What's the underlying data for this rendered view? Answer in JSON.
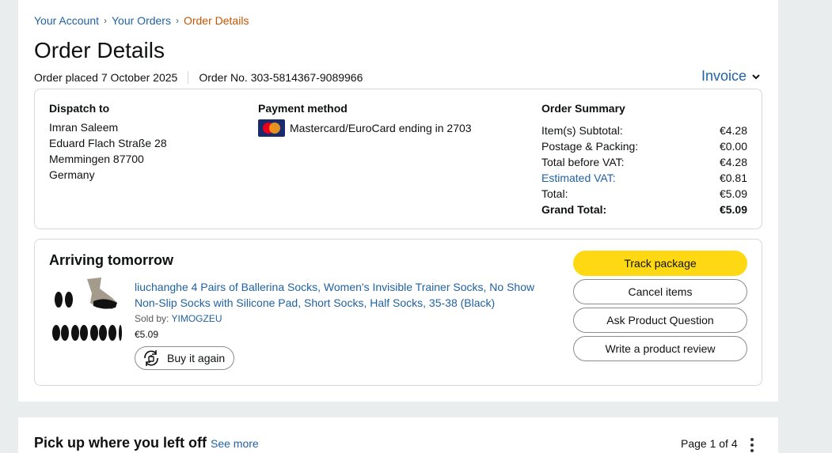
{
  "breadcrumb": {
    "items": [
      "Your Account",
      "Your Orders"
    ],
    "separator": "›",
    "current": "Order Details"
  },
  "page_title": "Order Details",
  "order_meta": {
    "placed": "Order placed 7 October 2025",
    "number": "Order No. 303-5814367-9089966"
  },
  "invoice_label": "Invoice",
  "dispatch": {
    "heading": "Dispatch to",
    "lines": [
      "Imran Saleem",
      "Eduard Flach Straße 28",
      "Memmingen 87700",
      "Germany"
    ]
  },
  "payment": {
    "heading": "Payment method",
    "card_text": "Mastercard/EuroCard ending in 2703",
    "icon": "mastercard-icon"
  },
  "summary": {
    "heading": "Order Summary",
    "rows": [
      {
        "label": "Item(s) Subtotal:",
        "value": "€4.28"
      },
      {
        "label": "Postage & Packing:",
        "value": "€0.00"
      },
      {
        "label": "Total before VAT:",
        "value": "€4.28"
      },
      {
        "label": "Estimated VAT:",
        "value": "€0.81"
      },
      {
        "label": "Total:",
        "value": "€5.09"
      },
      {
        "label": "Grand Total:",
        "value": "€5.09"
      }
    ]
  },
  "shipment": {
    "status": "Arriving tomorrow",
    "product_title": "liuchanghe 4 Pairs of Ballerina Socks, Women's Invisible Trainer Socks, No Show Non-Slip Socks with Silicone Pad, Short Socks, Half Socks, 35-38 (Black)",
    "sold_by_label": "Sold by:",
    "seller": "YIMOGZEU",
    "price": "€5.09",
    "buy_again": "Buy it again",
    "actions": [
      "Track package",
      "Cancel items",
      "Ask Product Question",
      "Write a product review"
    ]
  },
  "pickup": {
    "title": "Pick up where you left off",
    "see_more": "See more",
    "page": "Page 1 of 4"
  },
  "colors": {
    "link": "#2162a1",
    "breadcrumb_current": "#c45500",
    "primary_button": "#ffd814",
    "border": "#d5d9d9"
  }
}
